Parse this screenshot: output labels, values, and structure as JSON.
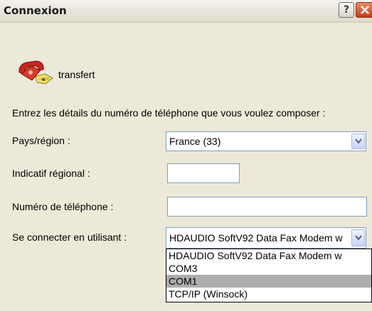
{
  "window": {
    "title": "Connexion"
  },
  "entry": {
    "name": "transfert"
  },
  "instructions": "Entrez les détails du numéro de téléphone que vous voulez composer :",
  "fields": {
    "country": {
      "label": "Pays/région :",
      "value": "France (33)"
    },
    "area_code": {
      "label": "Indicatif régional :",
      "value": ""
    },
    "phone": {
      "label": "Numéro de téléphone :",
      "value": ""
    },
    "connect_using": {
      "label": "Se connecter en utilisant :",
      "value": "HDAUDIO SoftV92 Data Fax Modem w",
      "options": [
        "HDAUDIO SoftV92 Data Fax Modem w",
        "COM3",
        "COM1",
        "TCP/IP (Winsock)"
      ],
      "highlighted": "COM1"
    }
  },
  "colors": {
    "background": "#ece9d8",
    "close_button": "#c63d1b",
    "highlight": "#adadad"
  },
  "icons": {
    "help": "question-mark-icon",
    "close": "close-x-icon",
    "entry": "telephone-icon",
    "dropdown": "chevron-down-icon"
  }
}
